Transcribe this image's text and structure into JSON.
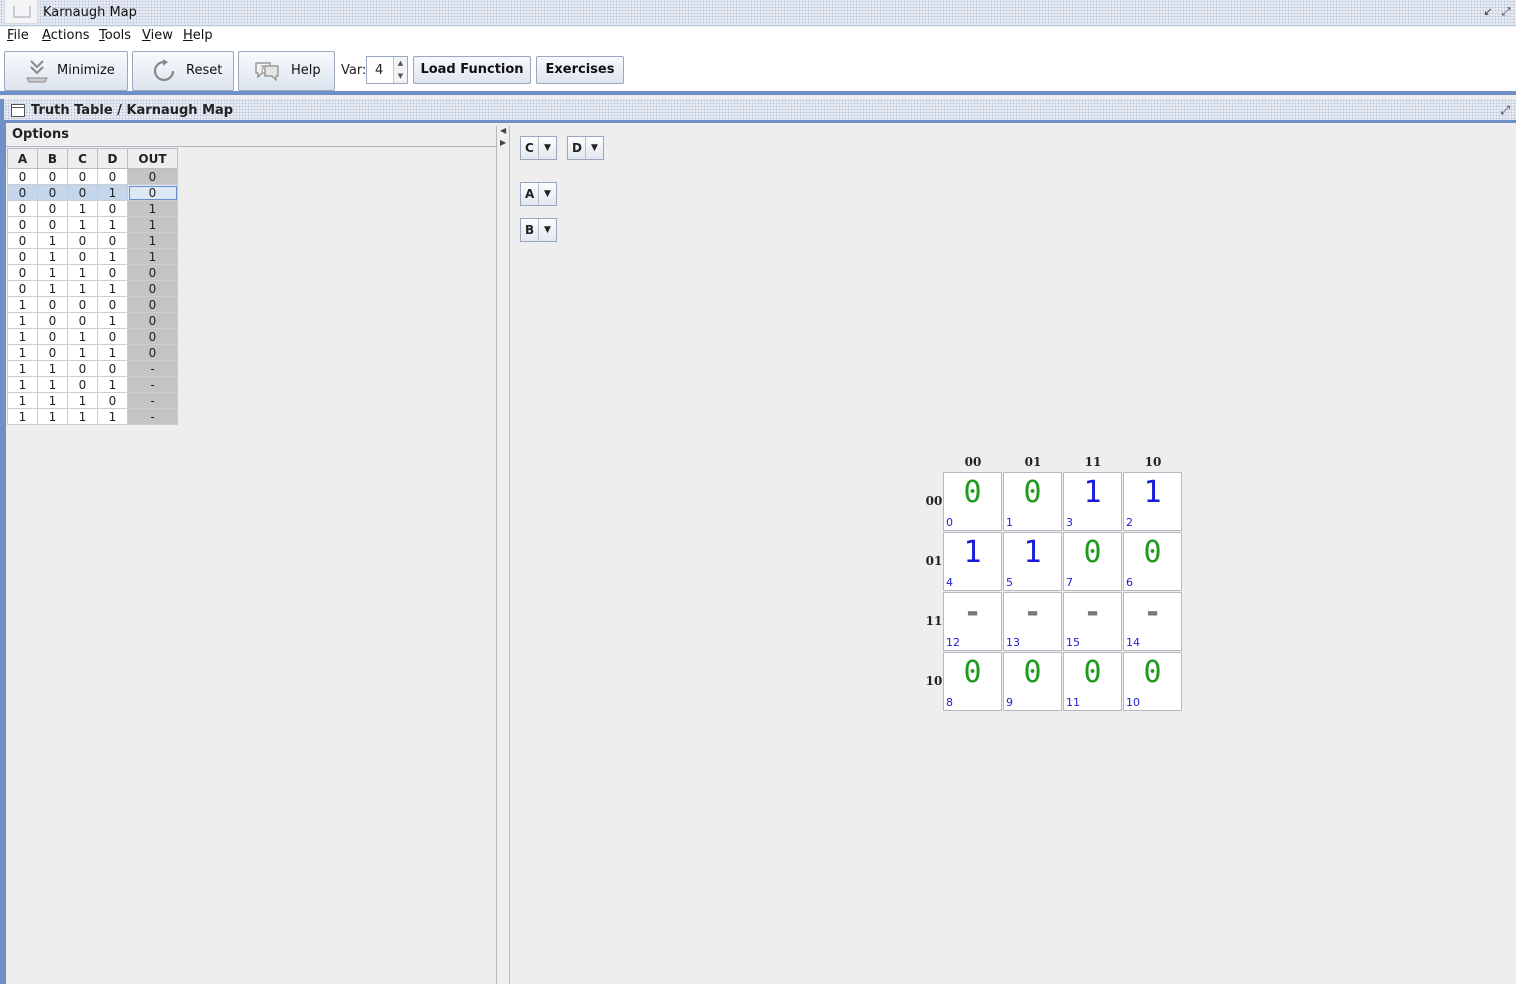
{
  "window": {
    "title": "Karnaugh Map"
  },
  "menu": [
    {
      "label": "File",
      "mnemonic": "F",
      "rest": "ile"
    },
    {
      "label": "Actions",
      "mnemonic": "A",
      "rest": "ctions"
    },
    {
      "label": "Tools",
      "mnemonic": "T",
      "rest": "ools"
    },
    {
      "label": "View",
      "mnemonic": "V",
      "rest": "iew"
    },
    {
      "label": "Help",
      "mnemonic": "H",
      "rest": "elp"
    }
  ],
  "toolbar": {
    "minimize_label": "Minimize",
    "reset_label": "Reset",
    "help_label": "Help",
    "var_label": "Var:",
    "var_value": "4",
    "load_function_label": "Load Function",
    "exercises_label": "Exercises"
  },
  "frame": {
    "title": "Truth Table / Karnaugh Map"
  },
  "left": {
    "options_title": "Options",
    "table": {
      "headers": [
        "A",
        "B",
        "C",
        "D",
        "OUT"
      ],
      "selected_row": 1,
      "rows": [
        [
          "0",
          "0",
          "0",
          "0",
          "0"
        ],
        [
          "0",
          "0",
          "0",
          "1",
          "0"
        ],
        [
          "0",
          "0",
          "1",
          "0",
          "1"
        ],
        [
          "0",
          "0",
          "1",
          "1",
          "1"
        ],
        [
          "0",
          "1",
          "0",
          "0",
          "1"
        ],
        [
          "0",
          "1",
          "0",
          "1",
          "1"
        ],
        [
          "0",
          "1",
          "1",
          "0",
          "0"
        ],
        [
          "0",
          "1",
          "1",
          "1",
          "0"
        ],
        [
          "1",
          "0",
          "0",
          "0",
          "0"
        ],
        [
          "1",
          "0",
          "0",
          "1",
          "0"
        ],
        [
          "1",
          "0",
          "1",
          "0",
          "0"
        ],
        [
          "1",
          "0",
          "1",
          "1",
          "0"
        ],
        [
          "1",
          "1",
          "0",
          "0",
          "-"
        ],
        [
          "1",
          "1",
          "0",
          "1",
          "-"
        ],
        [
          "1",
          "1",
          "1",
          "0",
          "-"
        ],
        [
          "1",
          "1",
          "1",
          "1",
          "-"
        ]
      ]
    }
  },
  "right": {
    "combos": {
      "col1": "C",
      "col2": "D",
      "row1": "A",
      "row2": "B"
    },
    "kmap": {
      "col_headers": [
        "00",
        "01",
        "11",
        "10"
      ],
      "row_headers": [
        "00",
        "01",
        "11",
        "10"
      ],
      "cells": [
        [
          {
            "v": "0",
            "i": "0"
          },
          {
            "v": "0",
            "i": "1"
          },
          {
            "v": "1",
            "i": "3"
          },
          {
            "v": "1",
            "i": "2"
          }
        ],
        [
          {
            "v": "1",
            "i": "4"
          },
          {
            "v": "1",
            "i": "5"
          },
          {
            "v": "0",
            "i": "7"
          },
          {
            "v": "0",
            "i": "6"
          }
        ],
        [
          {
            "v": "-",
            "i": "12"
          },
          {
            "v": "-",
            "i": "13"
          },
          {
            "v": "-",
            "i": "15"
          },
          {
            "v": "-",
            "i": "14"
          }
        ],
        [
          {
            "v": "0",
            "i": "8"
          },
          {
            "v": "0",
            "i": "9"
          },
          {
            "v": "0",
            "i": "11"
          },
          {
            "v": "0",
            "i": "10"
          }
        ]
      ]
    }
  },
  "colors": {
    "one": "#1a1adb",
    "zero": "#1f9a1f",
    "dont_care": "#777777",
    "accent": "#6f8fc9"
  }
}
